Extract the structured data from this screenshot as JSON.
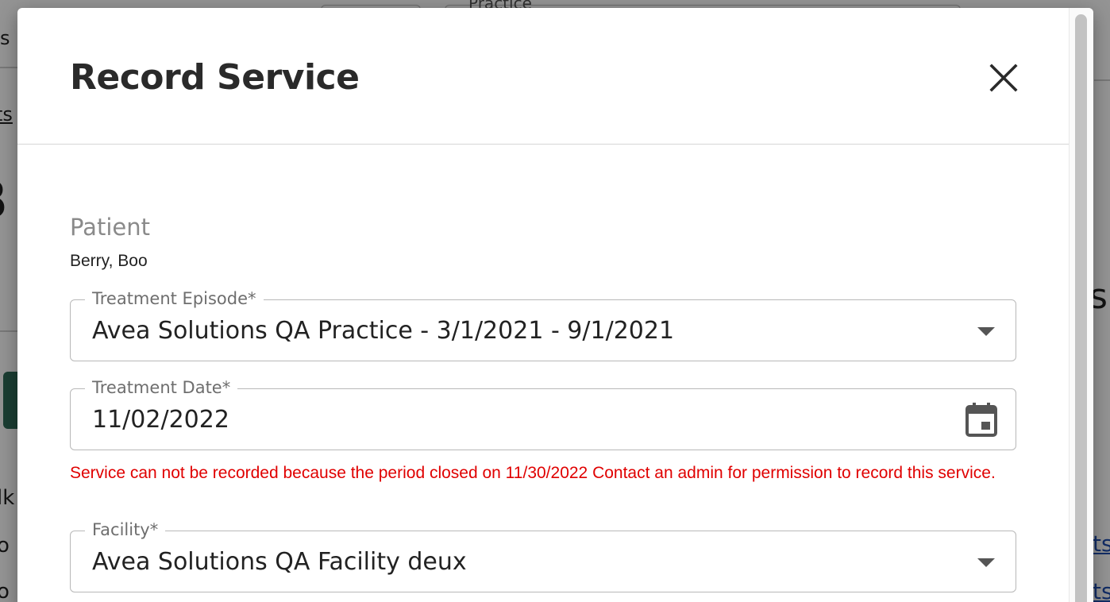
{
  "background": {
    "top_box_label": "Practice",
    "fragments": [
      "s",
      "ts",
      "B",
      "si",
      "lk",
      "o",
      "o"
    ],
    "links": [
      "ts",
      "ts"
    ]
  },
  "modal": {
    "title": "Record Service",
    "close_icon": "close-icon",
    "patient": {
      "label": "Patient",
      "name": "Berry, Boo"
    },
    "treatment_episode": {
      "label": "Treatment Episode*",
      "value": "Avea Solutions QA Practice - 3/1/2021 - 9/1/2021",
      "icon": "chevron-down-icon"
    },
    "treatment_date": {
      "label": "Treatment Date*",
      "value": "11/02/2022",
      "icon": "calendar-icon",
      "error": "Service can not be recorded because the period closed on 11/30/2022 Contact an admin for permission to record this service."
    },
    "facility": {
      "label": "Facility*",
      "value": "Avea Solutions QA Facility deux",
      "icon": "chevron-down-icon"
    }
  },
  "colors": {
    "error": "#e00000",
    "title": "#2a2a2a",
    "label": "#8a8a8a",
    "border": "#b8b8b8"
  }
}
